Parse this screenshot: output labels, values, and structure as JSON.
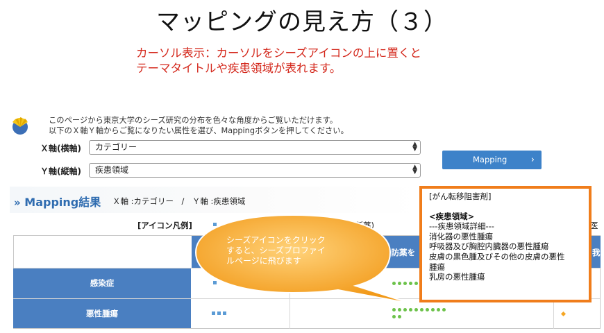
{
  "slide": {
    "title": "マッピングの見え方（３）",
    "caption_lines": [
      "カーソル表示：カーソルをシーズアイコンの上に置くと",
      "テーマタイトルや疾患領域が表れます。"
    ]
  },
  "intro_lines": [
    "このページから東京大学のシーズ研究の分布を色々な角度からご覧いただけます。",
    "以下のＸ軸Ｙ軸からご覧になりたい属性を選び、Mappingボタンを押してください。"
  ],
  "x_axis": {
    "label": "Ｘ軸(横軸)",
    "value": "カテゴリー"
  },
  "y_axis": {
    "label": "Ｙ軸(縦軸)",
    "value": "疾患領域"
  },
  "mapping_button": "Mapping",
  "results": {
    "title": "Mapping結果",
    "subtitle": "Ｘ軸 :カテゴリー　/　Ｙ軸 :疾患領域",
    "legend_label": "[アイコン凡例]",
    "legend_fragment": "診断薬)",
    "legend_fragment_right": "医",
    "col_fragment_left": "予防薬を",
    "col_fragment_right": "我",
    "rows": [
      "感染症",
      "悪性腫瘍"
    ]
  },
  "popup": {
    "tag": "[がん転移阻害剤]",
    "heading": "<疾患領域>",
    "detail_line": "---疾患領域詳細---",
    "items": [
      "消化器の悪性腫瘍",
      "呼吸器及び胸腔内臓器の悪性腫瘍",
      "皮膚の黒色腫及びその他の皮膚の悪性",
      "腫瘍",
      "乳房の悪性腫瘍"
    ]
  },
  "bubble_lines": [
    "シーズアイコンをクリック",
    "すると、シーズプロファイ",
    "ルページに飛びます"
  ],
  "colors": {
    "caption": "#d4281c",
    "blue": "#4a7fc1",
    "button": "#3d82c9",
    "popup_border": "#f07d1b",
    "bubble_fill": "#f5a623",
    "dot_green": "#6cc24a",
    "dot_blue": "#5b9bd5",
    "dot_orange": "#f5a623"
  }
}
